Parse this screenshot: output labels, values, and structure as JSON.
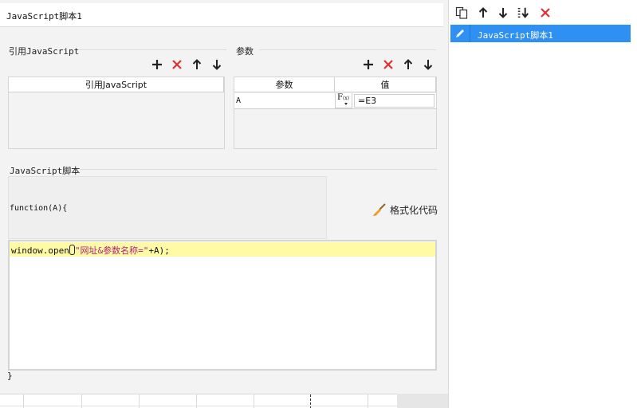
{
  "title": "JavaScript脚本1",
  "references": {
    "label": "引用JavaScript",
    "column_header": "引用JavaScript"
  },
  "params": {
    "label": "参数",
    "columns": {
      "name": "参数",
      "value": "值"
    },
    "rows": [
      {
        "name": "A",
        "fx_label": "F",
        "fx_sub": "(x)",
        "value": "=E3"
      }
    ]
  },
  "script": {
    "label": "JavaScript脚本",
    "header": "function(A){",
    "code_prefix": "window.open",
    "code_string": "\"网址&参数名称=\"",
    "code_suffix": "+A);",
    "footer": "}"
  },
  "format_button": {
    "label": "格式化代码"
  },
  "script_list": {
    "items": [
      {
        "label": "JavaScript脚本1",
        "selected": true
      }
    ]
  },
  "colors": {
    "add": "#222222",
    "delete": "#e03030",
    "selected": "#2f90f4",
    "highlight_line": "#fffaa5",
    "string": "#b0207a"
  }
}
